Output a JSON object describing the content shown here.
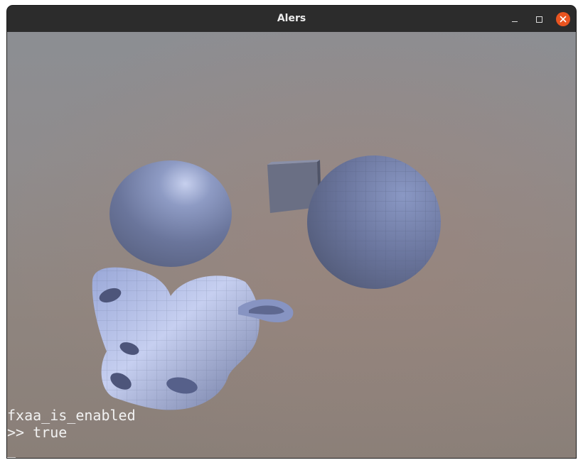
{
  "window": {
    "title": "Alers",
    "controls": {
      "minimize": "minimize-icon",
      "maximize": "maximize-icon",
      "close": "close-icon",
      "close_color": "#e95420"
    }
  },
  "viewport": {
    "background_top": "#8c8e93",
    "background_bottom": "#8a7f78",
    "object_color": "#7f8cb5"
  },
  "console": {
    "command": "fxaa_is_enabled",
    "output": ">> true",
    "cursor": "_"
  }
}
